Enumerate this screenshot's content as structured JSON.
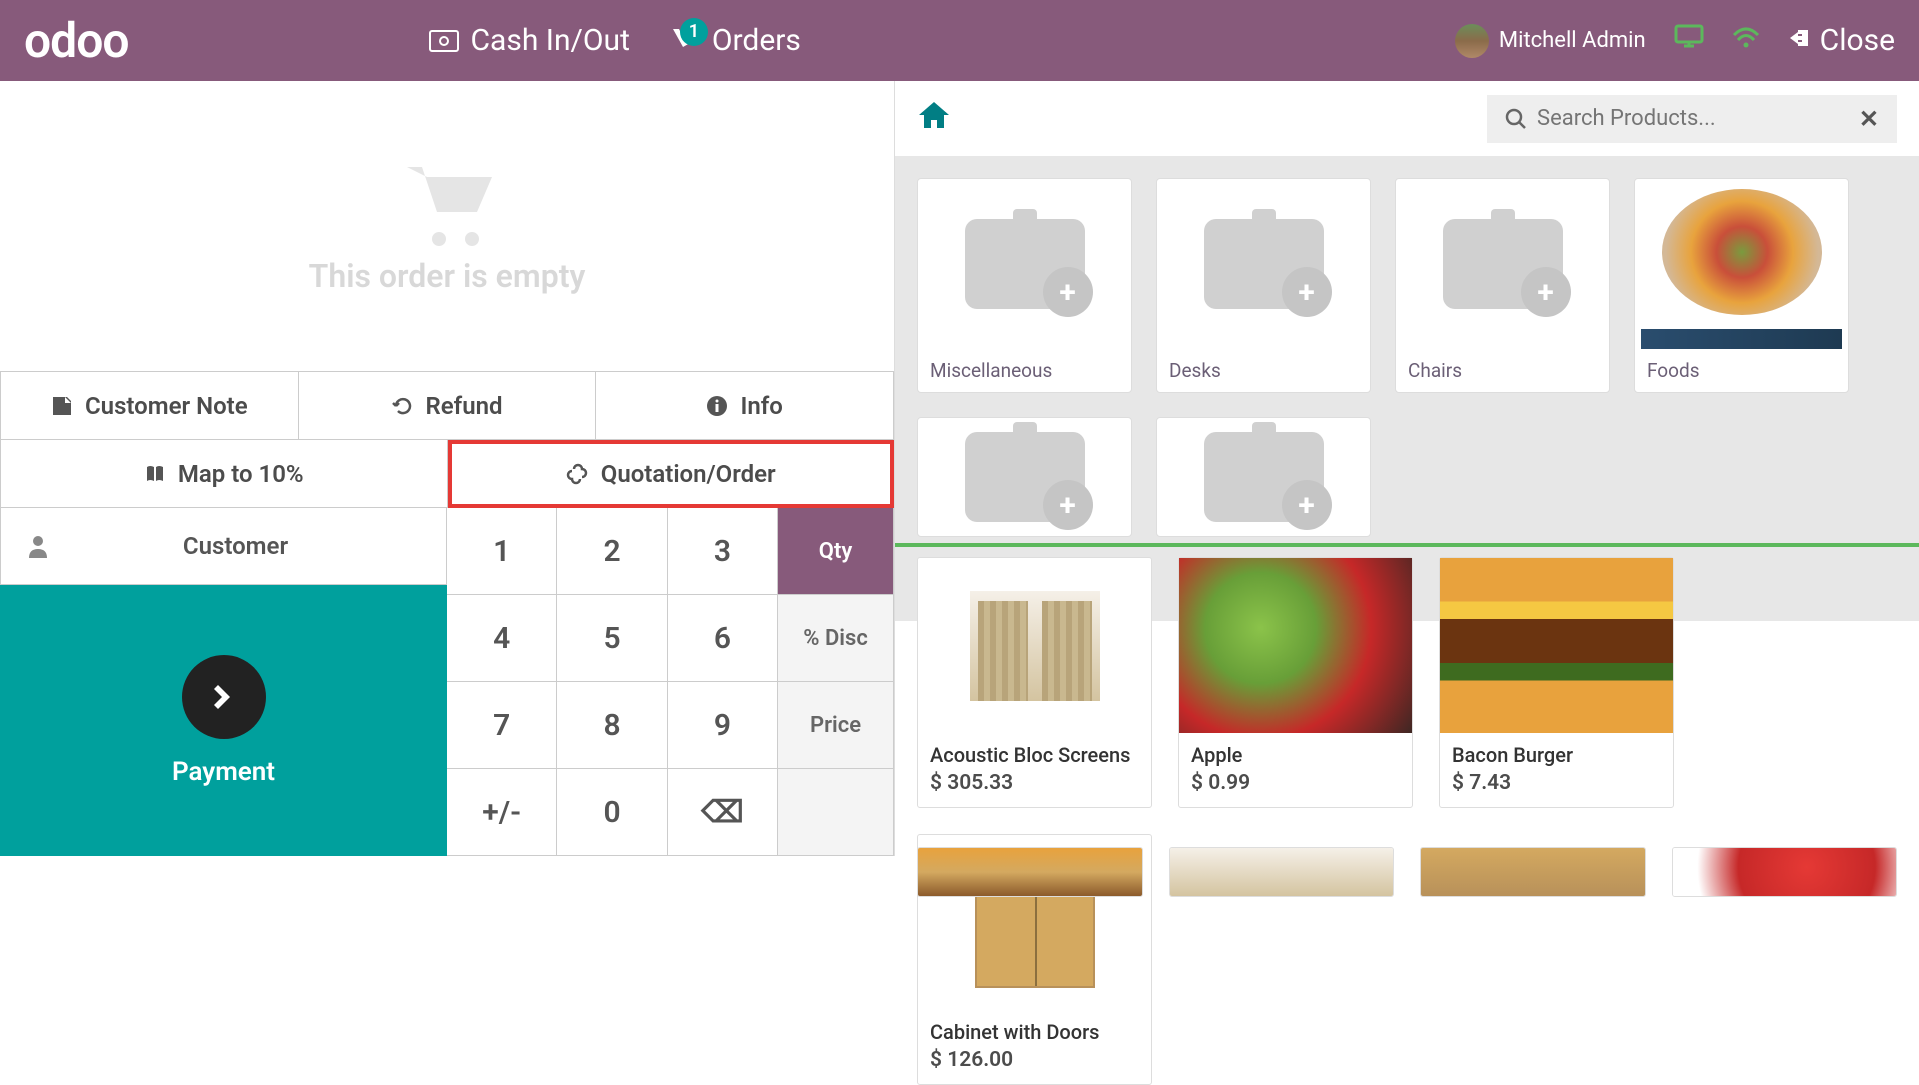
{
  "topbar": {
    "logo": "odoo",
    "cash_in_out": "Cash In/Out",
    "orders": "Orders",
    "orders_badge": "1",
    "user_name": "Mitchell Admin",
    "close": "Close"
  },
  "left": {
    "empty_order": "This order is empty",
    "customer_note": "Customer Note",
    "refund": "Refund",
    "info": "Info",
    "map_to_10": "Map to 10%",
    "quotation_order": "Quotation/Order",
    "customer": "Customer",
    "payment": "Payment",
    "keypad": {
      "k1": "1",
      "k2": "2",
      "k3": "3",
      "k4": "4",
      "k5": "5",
      "k6": "6",
      "k7": "7",
      "k8": "8",
      "k9": "9",
      "pm": "+/-",
      "k0": "0",
      "bs": "⌫",
      "qty": "Qty",
      "disc": "% Disc",
      "price": "Price"
    }
  },
  "right": {
    "search_placeholder": "Search Products...",
    "categories": [
      {
        "label": "Miscellaneous",
        "has_image": false
      },
      {
        "label": "Desks",
        "has_image": false
      },
      {
        "label": "Chairs",
        "has_image": false
      },
      {
        "label": "Foods",
        "has_image": true
      }
    ],
    "products": [
      {
        "name": "Acoustic Bloc Screens",
        "price": "$ 305.33"
      },
      {
        "name": "Apple",
        "price": "$ 0.99"
      },
      {
        "name": "Bacon Burger",
        "price": "$ 7.43"
      },
      {
        "name": "Cabinet with Doors",
        "price": "$ 126.00"
      }
    ]
  }
}
